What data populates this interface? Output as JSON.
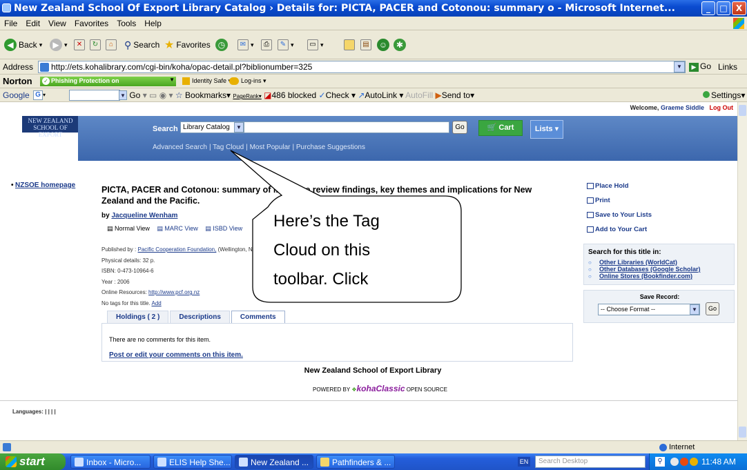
{
  "window": {
    "title": "New Zealand School Of Export Library Catalog › Details for: PICTA, PACER and Cotonou: summary o - Microsoft Internet...",
    "min": "_",
    "max": "□",
    "close": "X"
  },
  "menu": [
    "File",
    "Edit",
    "View",
    "Favorites",
    "Tools",
    "Help"
  ],
  "toolbar": {
    "back": "Back",
    "search": "Search",
    "favorites": "Favorites"
  },
  "address": {
    "label": "Address",
    "url": "http://ets.kohalibrary.com/cgi-bin/koha/opac-detail.pl?biblionumber=325",
    "go": "Go",
    "links": "Links"
  },
  "norton": {
    "brand": "Norton",
    "phishing": "Phishing Protection on",
    "identity": "Identity Safe ▾",
    "logins": "Log-ins ▾"
  },
  "google": {
    "brand": "Google",
    "items": [
      "Go",
      "Bookmarks▾",
      "PageRank▾",
      "486 blocked",
      "Check ▾",
      "AutoLink ▾",
      "AutoFill",
      "Send to▾"
    ],
    "settings": "Settings▾"
  },
  "page": {
    "welcome_prefix": "Welcome,",
    "welcome_user": "Graeme Siddle",
    "logout": "Log Out",
    "logo": "NEW ZEALAND SCHOOL OF EXPORT",
    "search_label": "Search",
    "catalog_option": "Library Catalog",
    "go": "Go",
    "cart": "Cart",
    "lists": "Lists ▾",
    "links": [
      "Advanced Search",
      "Tag Cloud",
      "Most Popular",
      "Purchase Suggestions"
    ],
    "nzsoe_home": "NZSOE homepage",
    "record_title": "PICTA, PACER and Cotonou: summary of literature review findings, key themes and implications for New Zealand and the Pacific.",
    "by": "by",
    "author": "Jacqueline Wenham",
    "views": [
      "Normal View",
      "MARC View",
      "ISBD View"
    ],
    "published_label": "Published by :",
    "publisher": "Pacific Cooperation Foundation,",
    "publisher_place": "(Wellington, N",
    "physical": "Physical details: 32 p.",
    "isbn": "ISBN: 0-473-10964-6",
    "year": "Year : 2006",
    "online_label": "Online Resources:",
    "online_url": "http://www.pcf.org.nz",
    "no_tags": "No tags for this title.",
    "add": "Add",
    "tabs": [
      "Holdings ( 2 )",
      "Descriptions",
      "Comments"
    ],
    "no_comments": "There are no comments for this item.",
    "post_comments": "Post or edit your comments on this item.",
    "footer": "New Zealand School of Export Library",
    "powered_by": "POWERED BY",
    "koha": "kohaClassic",
    "open_source": "OPEN SOURCE",
    "languages": "Languages: | | | |",
    "actions": [
      "Place Hold",
      "Print",
      "Save to Your Lists",
      "Add to Your Cart"
    ],
    "search_title_heading": "Search for this title in:",
    "search_title_links": [
      "Other Libraries (WorldCat)",
      "Other Databases (Google Scholar)",
      "Online Stores (Bookfinder.com)"
    ],
    "save_record": "Save Record:",
    "choose_format": "-- Choose Format --",
    "save_go": "Go"
  },
  "callout": {
    "line1": "Here’s the Tag",
    "line2": "Cloud on this",
    "line3": "toolbar.  Click"
  },
  "status": {
    "zone": "Internet"
  },
  "taskbar": {
    "start": "start",
    "tasks": [
      "Inbox - Micro...",
      "ELIS Help She...",
      "New Zealand ...",
      "Pathfinders & ..."
    ],
    "lang": "EN",
    "search_desktop": "Search Desktop",
    "clock": "11:48 AM"
  }
}
